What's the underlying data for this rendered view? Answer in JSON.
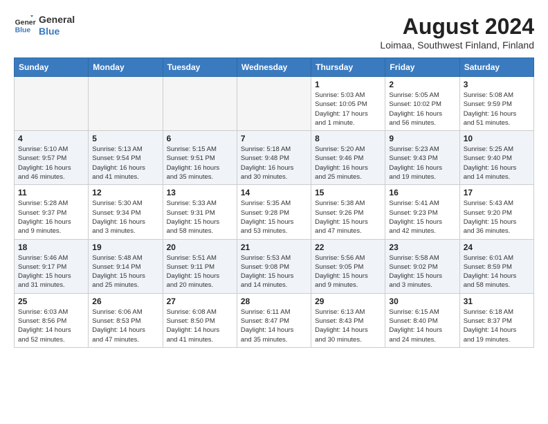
{
  "header": {
    "logo": {
      "line1": "General",
      "line2": "Blue"
    },
    "title": "August 2024",
    "subtitle": "Loimaa, Southwest Finland, Finland"
  },
  "calendar": {
    "weekdays": [
      "Sunday",
      "Monday",
      "Tuesday",
      "Wednesday",
      "Thursday",
      "Friday",
      "Saturday"
    ],
    "weeks": [
      [
        {
          "day": "",
          "info": ""
        },
        {
          "day": "",
          "info": ""
        },
        {
          "day": "",
          "info": ""
        },
        {
          "day": "",
          "info": ""
        },
        {
          "day": "1",
          "info": "Sunrise: 5:03 AM\nSunset: 10:05 PM\nDaylight: 17 hours\nand 1 minute."
        },
        {
          "day": "2",
          "info": "Sunrise: 5:05 AM\nSunset: 10:02 PM\nDaylight: 16 hours\nand 56 minutes."
        },
        {
          "day": "3",
          "info": "Sunrise: 5:08 AM\nSunset: 9:59 PM\nDaylight: 16 hours\nand 51 minutes."
        }
      ],
      [
        {
          "day": "4",
          "info": "Sunrise: 5:10 AM\nSunset: 9:57 PM\nDaylight: 16 hours\nand 46 minutes."
        },
        {
          "day": "5",
          "info": "Sunrise: 5:13 AM\nSunset: 9:54 PM\nDaylight: 16 hours\nand 41 minutes."
        },
        {
          "day": "6",
          "info": "Sunrise: 5:15 AM\nSunset: 9:51 PM\nDaylight: 16 hours\nand 35 minutes."
        },
        {
          "day": "7",
          "info": "Sunrise: 5:18 AM\nSunset: 9:48 PM\nDaylight: 16 hours\nand 30 minutes."
        },
        {
          "day": "8",
          "info": "Sunrise: 5:20 AM\nSunset: 9:46 PM\nDaylight: 16 hours\nand 25 minutes."
        },
        {
          "day": "9",
          "info": "Sunrise: 5:23 AM\nSunset: 9:43 PM\nDaylight: 16 hours\nand 19 minutes."
        },
        {
          "day": "10",
          "info": "Sunrise: 5:25 AM\nSunset: 9:40 PM\nDaylight: 16 hours\nand 14 minutes."
        }
      ],
      [
        {
          "day": "11",
          "info": "Sunrise: 5:28 AM\nSunset: 9:37 PM\nDaylight: 16 hours\nand 9 minutes."
        },
        {
          "day": "12",
          "info": "Sunrise: 5:30 AM\nSunset: 9:34 PM\nDaylight: 16 hours\nand 3 minutes."
        },
        {
          "day": "13",
          "info": "Sunrise: 5:33 AM\nSunset: 9:31 PM\nDaylight: 15 hours\nand 58 minutes."
        },
        {
          "day": "14",
          "info": "Sunrise: 5:35 AM\nSunset: 9:28 PM\nDaylight: 15 hours\nand 53 minutes."
        },
        {
          "day": "15",
          "info": "Sunrise: 5:38 AM\nSunset: 9:26 PM\nDaylight: 15 hours\nand 47 minutes."
        },
        {
          "day": "16",
          "info": "Sunrise: 5:41 AM\nSunset: 9:23 PM\nDaylight: 15 hours\nand 42 minutes."
        },
        {
          "day": "17",
          "info": "Sunrise: 5:43 AM\nSunset: 9:20 PM\nDaylight: 15 hours\nand 36 minutes."
        }
      ],
      [
        {
          "day": "18",
          "info": "Sunrise: 5:46 AM\nSunset: 9:17 PM\nDaylight: 15 hours\nand 31 minutes."
        },
        {
          "day": "19",
          "info": "Sunrise: 5:48 AM\nSunset: 9:14 PM\nDaylight: 15 hours\nand 25 minutes."
        },
        {
          "day": "20",
          "info": "Sunrise: 5:51 AM\nSunset: 9:11 PM\nDaylight: 15 hours\nand 20 minutes."
        },
        {
          "day": "21",
          "info": "Sunrise: 5:53 AM\nSunset: 9:08 PM\nDaylight: 15 hours\nand 14 minutes."
        },
        {
          "day": "22",
          "info": "Sunrise: 5:56 AM\nSunset: 9:05 PM\nDaylight: 15 hours\nand 9 minutes."
        },
        {
          "day": "23",
          "info": "Sunrise: 5:58 AM\nSunset: 9:02 PM\nDaylight: 15 hours\nand 3 minutes."
        },
        {
          "day": "24",
          "info": "Sunrise: 6:01 AM\nSunset: 8:59 PM\nDaylight: 14 hours\nand 58 minutes."
        }
      ],
      [
        {
          "day": "25",
          "info": "Sunrise: 6:03 AM\nSunset: 8:56 PM\nDaylight: 14 hours\nand 52 minutes."
        },
        {
          "day": "26",
          "info": "Sunrise: 6:06 AM\nSunset: 8:53 PM\nDaylight: 14 hours\nand 47 minutes."
        },
        {
          "day": "27",
          "info": "Sunrise: 6:08 AM\nSunset: 8:50 PM\nDaylight: 14 hours\nand 41 minutes."
        },
        {
          "day": "28",
          "info": "Sunrise: 6:11 AM\nSunset: 8:47 PM\nDaylight: 14 hours\nand 35 minutes."
        },
        {
          "day": "29",
          "info": "Sunrise: 6:13 AM\nSunset: 8:43 PM\nDaylight: 14 hours\nand 30 minutes."
        },
        {
          "day": "30",
          "info": "Sunrise: 6:15 AM\nSunset: 8:40 PM\nDaylight: 14 hours\nand 24 minutes."
        },
        {
          "day": "31",
          "info": "Sunrise: 6:18 AM\nSunset: 8:37 PM\nDaylight: 14 hours\nand 19 minutes."
        }
      ]
    ]
  }
}
